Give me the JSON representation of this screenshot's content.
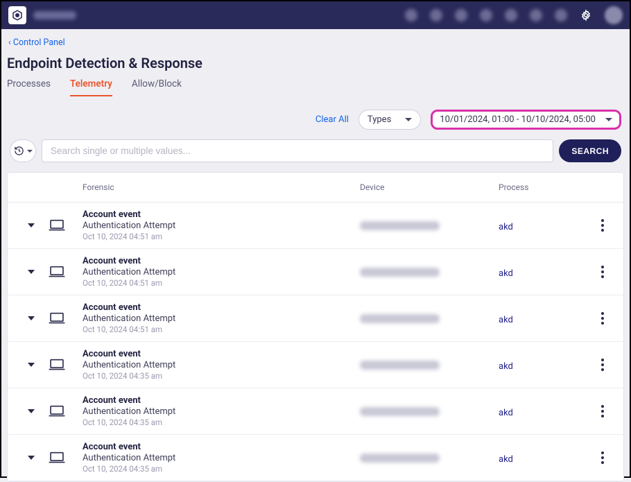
{
  "breadcrumb": {
    "prefix": "‹ ",
    "label": "Control Panel"
  },
  "page_title": "Endpoint Detection & Response",
  "tabs": {
    "processes": "Processes",
    "telemetry": "Telemetry",
    "allow_block": "Allow/Block"
  },
  "filters": {
    "clear_all": "Clear All",
    "types_label": "Types",
    "date_range": "10/01/2024, 01:00 - 10/10/2024, 05:00"
  },
  "search": {
    "placeholder": "Search single or multiple values...",
    "button": "SEARCH"
  },
  "columns": {
    "forensic": "Forensic",
    "device": "Device",
    "process": "Process"
  },
  "rows": [
    {
      "title": "Account event",
      "subtitle": "Authentication Attempt",
      "timestamp": "Oct 10, 2024 04:51 am",
      "process": "akd"
    },
    {
      "title": "Account event",
      "subtitle": "Authentication Attempt",
      "timestamp": "Oct 10, 2024 04:51 am",
      "process": "akd"
    },
    {
      "title": "Account event",
      "subtitle": "Authentication Attempt",
      "timestamp": "Oct 10, 2024 04:51 am",
      "process": "akd"
    },
    {
      "title": "Account event",
      "subtitle": "Authentication Attempt",
      "timestamp": "Oct 10, 2024 04:35 am",
      "process": "akd"
    },
    {
      "title": "Account event",
      "subtitle": "Authentication Attempt",
      "timestamp": "Oct 10, 2024 04:35 am",
      "process": "akd"
    },
    {
      "title": "Account event",
      "subtitle": "Authentication Attempt",
      "timestamp": "Oct 10, 2024 04:35 am",
      "process": "akd"
    }
  ]
}
